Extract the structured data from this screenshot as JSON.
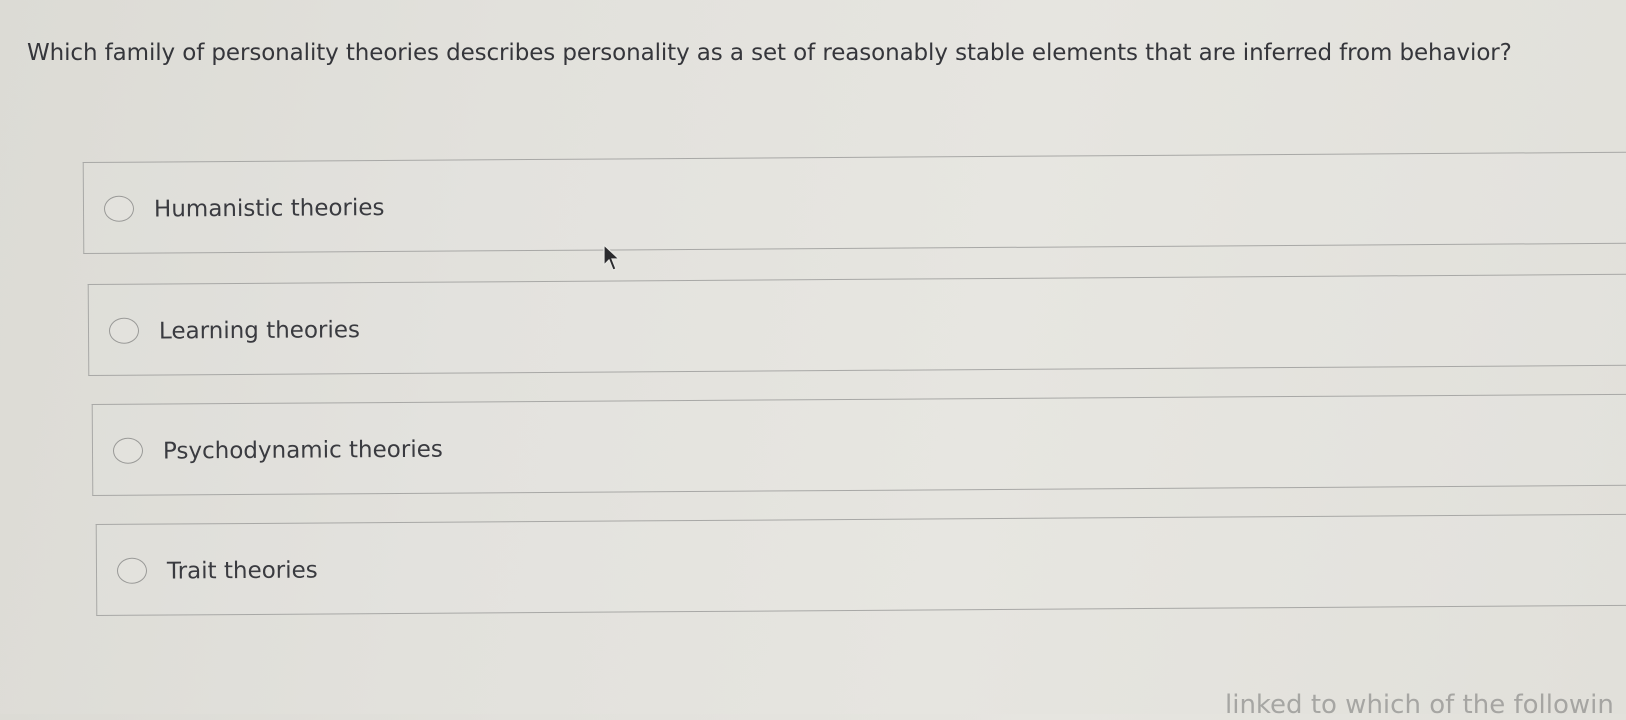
{
  "question": {
    "text": "Which family of personality theories describes personality as a set of reasonably stable elements that are inferred from behavior?"
  },
  "options": [
    {
      "label": "Humanistic theories",
      "selected": false
    },
    {
      "label": "Learning theories",
      "selected": false
    },
    {
      "label": "Psychodynamic theories",
      "selected": false
    },
    {
      "label": "Trait theories",
      "selected": false
    }
  ],
  "next_question_fragment": "linked to which of the followin"
}
